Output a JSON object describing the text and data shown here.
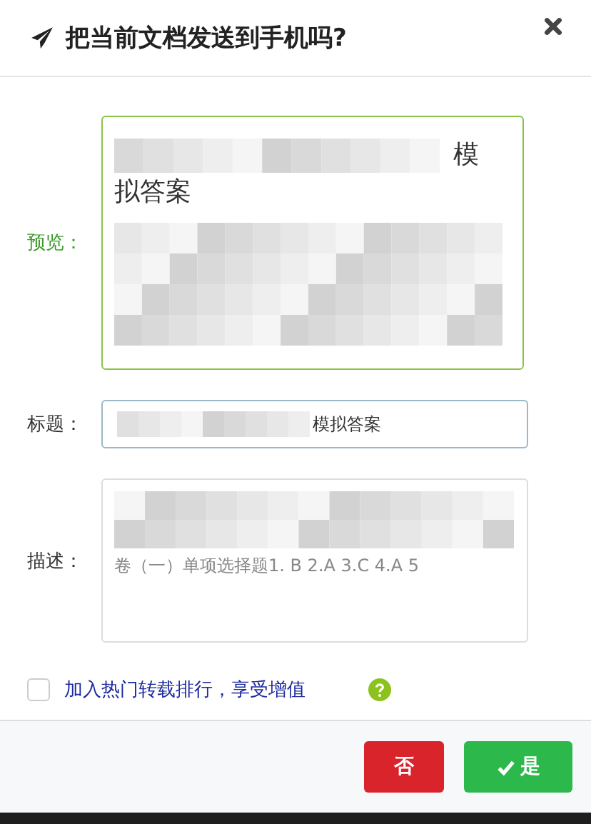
{
  "dialog": {
    "title": "把当前文档发送到手机吗?"
  },
  "form": {
    "preview": {
      "label": "预览：",
      "text_lines": [
        "模",
        "拟答案"
      ],
      "focused": true
    },
    "title_field": {
      "label": "标题：",
      "value": "模拟答案"
    },
    "description": {
      "label": "描述：",
      "value": "卷（一）单项选择题1. B 2.A 3.C 4.A 5"
    }
  },
  "hot_ranking": {
    "label": "加入热门转载排行，享受增值",
    "checked": false
  },
  "buttons": [
    {
      "label": "否",
      "kind": "cancel"
    },
    {
      "label": "是",
      "kind": "confirm"
    }
  ]
}
